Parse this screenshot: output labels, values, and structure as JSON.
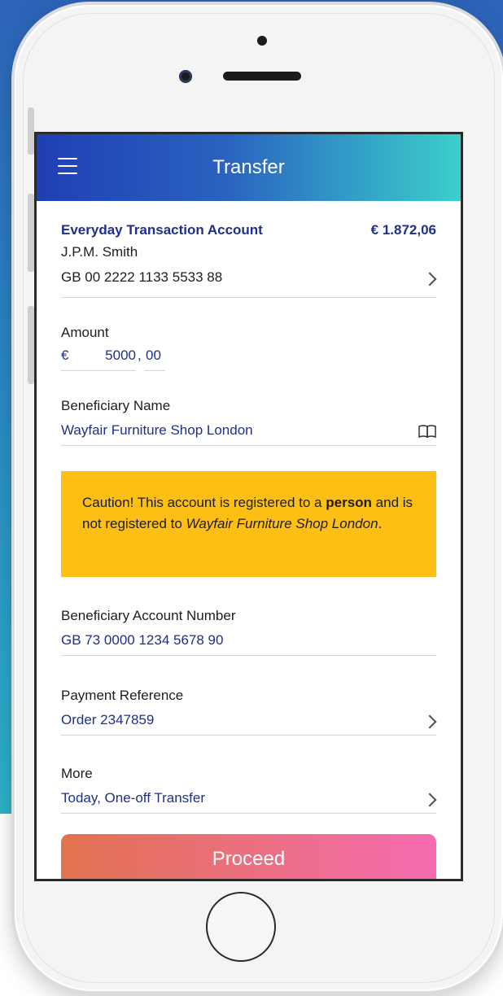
{
  "header": {
    "title": "Transfer",
    "menu_icon": "hamburger-menu-icon"
  },
  "account": {
    "name": "Everyday Transaction Account",
    "balance": "€ 1.872,06",
    "holder": "J.P.M. Smith",
    "iban": "GB 00 2222 1133 5533 88"
  },
  "amount": {
    "label": "Amount",
    "currency": "€",
    "integer_value": "5000",
    "separator": ",",
    "decimal_value": "00"
  },
  "beneficiary_name": {
    "label": "Beneficiary Name",
    "value": "Wayfair Furniture Shop London",
    "icon": "address-book-icon"
  },
  "caution": {
    "prefix": "Caution! This account is registered to a",
    "emphasis": "person",
    "middle": "and is not registered to",
    "name": "Wayfair Furniture Shop London",
    "suffix": ".",
    "color": "#fdbf14"
  },
  "beneficiary_account": {
    "label": "Beneficiary Account Number",
    "value": "GB 73 0000 1234 5678 90"
  },
  "payment_reference": {
    "label": "Payment Reference",
    "value": "Order 2347859"
  },
  "more": {
    "label": "More",
    "value": "Today, One-off Transfer"
  },
  "proceed": {
    "label": "Proceed"
  },
  "colors": {
    "accent_text": "#1e2f8c",
    "header_start": "#1f3fb4",
    "header_end": "#3ad0cb",
    "button_start": "#e3724f",
    "button_end": "#f56bb1"
  }
}
